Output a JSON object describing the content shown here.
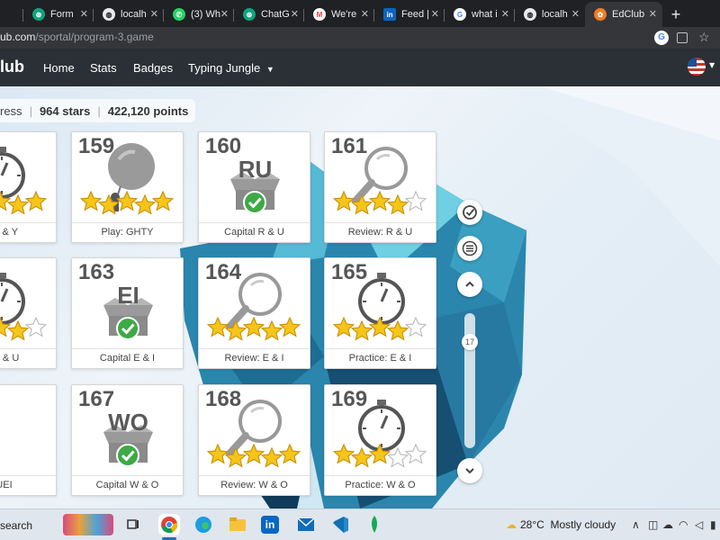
{
  "browser": {
    "tabs": [
      {
        "label": "",
        "icon": "tab-icon",
        "color": "#333"
      },
      {
        "label": "Form",
        "icon": "chatgpt-icon",
        "color": "#10a37f"
      },
      {
        "label": "localh",
        "icon": "globe-icon",
        "color": "#e8eaed"
      },
      {
        "label": "(3) Wh",
        "icon": "whatsapp-icon",
        "color": "#25d366"
      },
      {
        "label": "ChatG",
        "icon": "chatgpt-icon",
        "color": "#10a37f"
      },
      {
        "label": "We're",
        "icon": "gmail-icon",
        "color": "#ea4335"
      },
      {
        "label": "Feed |",
        "icon": "linkedin-icon",
        "color": "#0a66c2"
      },
      {
        "label": "what i",
        "icon": "google-icon",
        "color": "#ffffff"
      },
      {
        "label": "localh",
        "icon": "globe-icon",
        "color": "#e8eaed"
      },
      {
        "label": "EdClub",
        "icon": "edclub-icon",
        "color": "#f47b20"
      }
    ],
    "url_domain": "ub.com",
    "url_path": "/sportal/program-3.game"
  },
  "site": {
    "brand": "lub",
    "nav": [
      "Home",
      "Stats",
      "Badges",
      "Typing Jungle"
    ],
    "language_flag": "us-flag-icon"
  },
  "stats": {
    "progress_fragment": "ress",
    "stars": "964 stars",
    "points": "422,120 points"
  },
  "cards": [
    {
      "num": "",
      "code": "",
      "type": "timer",
      "stars": 5,
      "label": "e: T & Y"
    },
    {
      "num": "159",
      "code": "",
      "type": "balloon",
      "stars": 5,
      "label": "Play: GHTY"
    },
    {
      "num": "160",
      "code": "RU",
      "type": "capital",
      "stars": 0,
      "label": "Capital R & U"
    },
    {
      "num": "161",
      "code": "",
      "type": "review",
      "stars": 4,
      "label": "Review: R & U"
    },
    {
      "num": "",
      "code": "",
      "type": "timer",
      "stars": 4,
      "label": "e: R & U"
    },
    {
      "num": "163",
      "code": "EI",
      "type": "capital",
      "stars": 0,
      "label": "Capital E & I"
    },
    {
      "num": "164",
      "code": "",
      "type": "review",
      "stars": 5,
      "label": "Review: E & I"
    },
    {
      "num": "165",
      "code": "",
      "type": "timer",
      "stars": 4,
      "label": "Practice: E & I"
    },
    {
      "num": "",
      "code": "",
      "type": "game",
      "stars": 0,
      "label": "RUEI"
    },
    {
      "num": "167",
      "code": "WO",
      "type": "capital",
      "stars": 0,
      "label": "Capital W & O"
    },
    {
      "num": "168",
      "code": "",
      "type": "review",
      "stars": 5,
      "label": "Review: W & O"
    },
    {
      "num": "169",
      "code": "",
      "type": "timer",
      "stars": 3,
      "label": "Practice: W & O"
    }
  ],
  "scroll": {
    "level": "17"
  },
  "taskbar": {
    "search": "search",
    "weather_temp": "28°C",
    "weather_text": "Mostly cloudy"
  },
  "colors": {
    "star": "#f5c518",
    "check": "#3daa45",
    "nav_bg": "#2b3036",
    "tab_bg": "#202124"
  }
}
